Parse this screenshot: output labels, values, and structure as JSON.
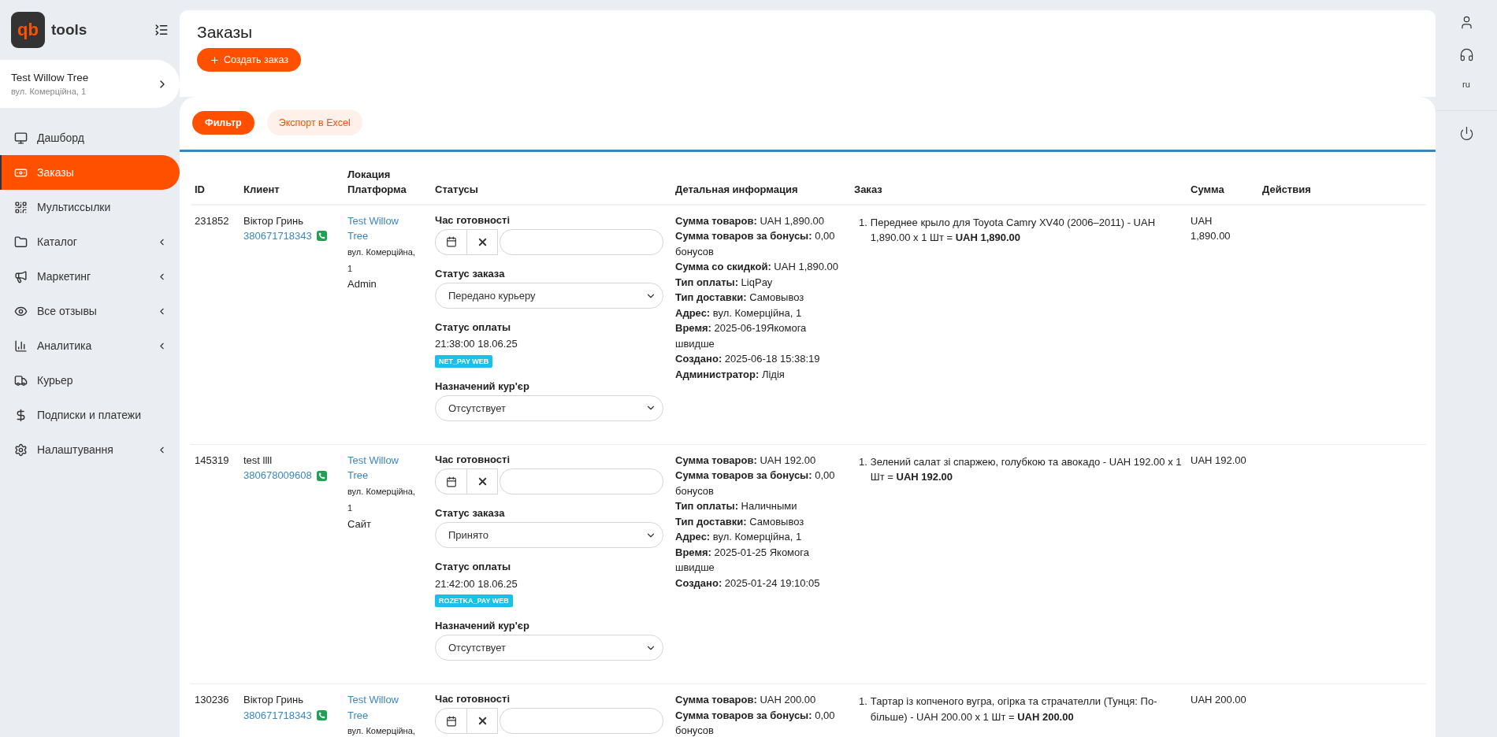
{
  "brand": {
    "logo_text": "qb",
    "name": "tools"
  },
  "store": {
    "name": "Test Willow Tree",
    "address": "вул. Комерційна, 1"
  },
  "menu": [
    {
      "label": "Дашборд",
      "selected": false,
      "has_submenu": false
    },
    {
      "label": "Заказы",
      "selected": true,
      "has_submenu": false
    },
    {
      "label": "Мультиссылки",
      "selected": false,
      "has_submenu": false
    },
    {
      "label": "Каталог",
      "selected": false,
      "has_submenu": true
    },
    {
      "label": "Маркетинг",
      "selected": false,
      "has_submenu": true
    },
    {
      "label": "Все отзывы",
      "selected": false,
      "has_submenu": true
    },
    {
      "label": "Аналитика",
      "selected": false,
      "has_submenu": true
    },
    {
      "label": "Курьер",
      "selected": false,
      "has_submenu": false
    },
    {
      "label": "Подписки и платежи",
      "selected": false,
      "has_submenu": false
    },
    {
      "label": "Налаштування",
      "selected": false,
      "has_submenu": true
    }
  ],
  "page": {
    "title": "Заказы",
    "create_button": "Создать заказ"
  },
  "toolbar": {
    "filter_button": "Фильтр",
    "export_button": "Экспорт в Excel"
  },
  "table": {
    "columns": [
      "ID",
      "Клиент",
      "Локация Платформа",
      "Статусы",
      "Детальная информация",
      "Заказ",
      "Сумма",
      "Действия"
    ],
    "rows": [
      {
        "id": "231852",
        "client": "Віктор Гринь",
        "phone": "380671718343",
        "location": "Test Willow Tree",
        "address": "вул. Комерційна, 1",
        "platform": "Admin",
        "ready_label": "Час готовності",
        "order_status_label": "Статус заказа",
        "order_status": "Передано курьеру",
        "payment_label": "Статус оплаты",
        "payment_time": "21:38:00 18.06.25",
        "payment_badge": "NET_PAY WEB",
        "courier_label": "Назначений кур'єр",
        "courier": "Отсутствует",
        "details": [
          {
            "label": "Сумма товаров:",
            "value": "UAH 1,890.00"
          },
          {
            "label": "Сумма товаров за бонусы:",
            "value": "0,00 бонусов"
          },
          {
            "label": "Сумма со скидкой:",
            "value": "UAH 1,890.00"
          },
          {
            "label": "Тип оплаты:",
            "value": "LiqPay"
          },
          {
            "label": "Тип доставки:",
            "value": "Самовывоз"
          },
          {
            "label": "Адрес:",
            "value": "вул. Комерційна, 1"
          },
          {
            "label": "Время:",
            "value": "2025-06-19Якомога швидше"
          },
          {
            "label": "Создано:",
            "value": "2025-06-18 15:38:19"
          },
          {
            "label": "Администратор:",
            "value": "Лідія"
          }
        ],
        "items": [
          {
            "number": "1.",
            "text": "Переднее крыло для Toyota Camry XV40 (2006–2011) - UAH 1,890.00 x 1 Шт = **UAH 1,890.00**"
          }
        ],
        "sum": "UAH 1,890.00"
      },
      {
        "id": "145319",
        "client": "test llll",
        "phone": "380678009608",
        "location": "Test Willow Tree",
        "address": "вул. Комерційна, 1",
        "platform": "Сайт",
        "ready_label": "Час готовності",
        "order_status_label": "Статус заказа",
        "order_status": "Принято",
        "payment_label": "Статус оплаты",
        "payment_time": "21:42:00 18.06.25",
        "payment_badge": "ROZETKA_PAY WEB",
        "courier_label": "Назначений кур'єр",
        "courier": "Отсутствует",
        "details": [
          {
            "label": "Сумма товаров:",
            "value": "UAH 192.00"
          },
          {
            "label": "Сумма товаров за бонусы:",
            "value": "0,00 бонусов"
          },
          {
            "label": "Тип оплаты:",
            "value": "Наличными"
          },
          {
            "label": "Тип доставки:",
            "value": "Самовывоз"
          },
          {
            "label": "Адрес:",
            "value": "вул. Комерційна, 1"
          },
          {
            "label": "Время:",
            "value": "2025-01-25 Якомога швидше"
          },
          {
            "label": "Создано:",
            "value": "2025-01-24 19:10:05"
          }
        ],
        "items": [
          {
            "number": "1.",
            "text": "Зелений салат зі спаржею, голубкою та авокадо - UAH 192.00 x 1 Шт = **UAH 192.00**"
          }
        ],
        "sum": "UAH 192.00"
      },
      {
        "id": "130236",
        "client": "Віктор Гринь",
        "phone": "380671718343",
        "location": "Test Willow Tree",
        "address": "вул. Комерційна,",
        "ready_label": "Час готовності",
        "details": [
          {
            "label": "Сумма товаров:",
            "value": "UAH 200.00"
          },
          {
            "label": "Сумма товаров за бонусы:",
            "value": "0,00 бонусов"
          }
        ],
        "items": [
          {
            "number": "1.",
            "text": "Тартар із копченого вугра, огірка та страчателли (Тунця: По-більше) - UAH 200.00 x 1 Шт = **UAH 200.00**"
          }
        ],
        "sum": "UAH 200.00"
      }
    ]
  },
  "rail": {
    "language": "ru"
  }
}
